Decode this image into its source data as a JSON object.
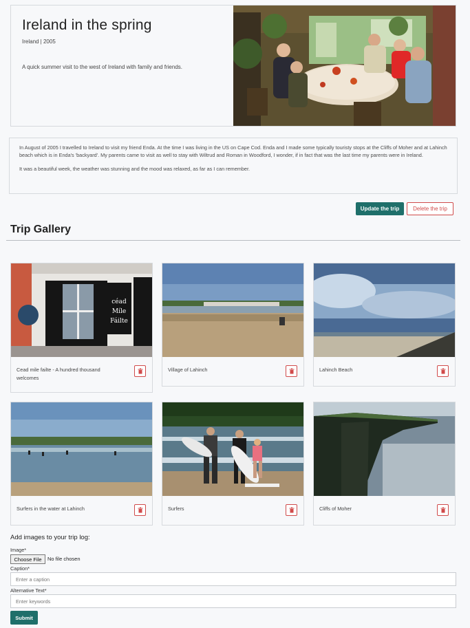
{
  "trip": {
    "title": "Ireland in the spring",
    "meta": "Ireland | 2005",
    "summary": "A quick summer visit to the west of Ireland with family and friends."
  },
  "story": {
    "paragraph1": "In August of 2005 I travelled to Ireland to visit my friend Enda. At the time I was living in the US on Cape Cod. Enda and I made some typically touristy stops at the Cliffs of Moher and at Lahinch beach which is in Enda's 'backyard'. My parents came to visit as well to stay with Wiltrud and Roman in Woodford, I wonder, if in fact that was the last time my parents were in Ireland.",
    "paragraph2": "It was a beautiful week, the weather was stunning and the mood was relaxed, as far as I can remember."
  },
  "actions": {
    "update_label": "Update the trip",
    "delete_label": "Delete the trip"
  },
  "gallery": {
    "title": "Trip Gallery",
    "items": [
      {
        "caption": "Cead mile failte - A hundred thousand welcomes"
      },
      {
        "caption": "Village of Lahinch"
      },
      {
        "caption": "Lahinch Beach"
      },
      {
        "caption": "Surfers in the water at Lahinch"
      },
      {
        "caption": "Surfers"
      },
      {
        "caption": "Cliffs of Moher"
      }
    ],
    "delete_icon": "trash-icon"
  },
  "form": {
    "title": "Add images to your trip log:",
    "image_label": "Image*",
    "file_button": "Choose File",
    "file_status": "No file chosen",
    "caption_label": "Caption*",
    "caption_placeholder": "Enter a caption",
    "alt_label": "Alternative Text*",
    "alt_placeholder": "Enter keywords",
    "submit_label": "Submit"
  },
  "colors": {
    "primary": "#1f6f6a",
    "danger": "#d04a4a",
    "background": "#f7f8fa"
  }
}
